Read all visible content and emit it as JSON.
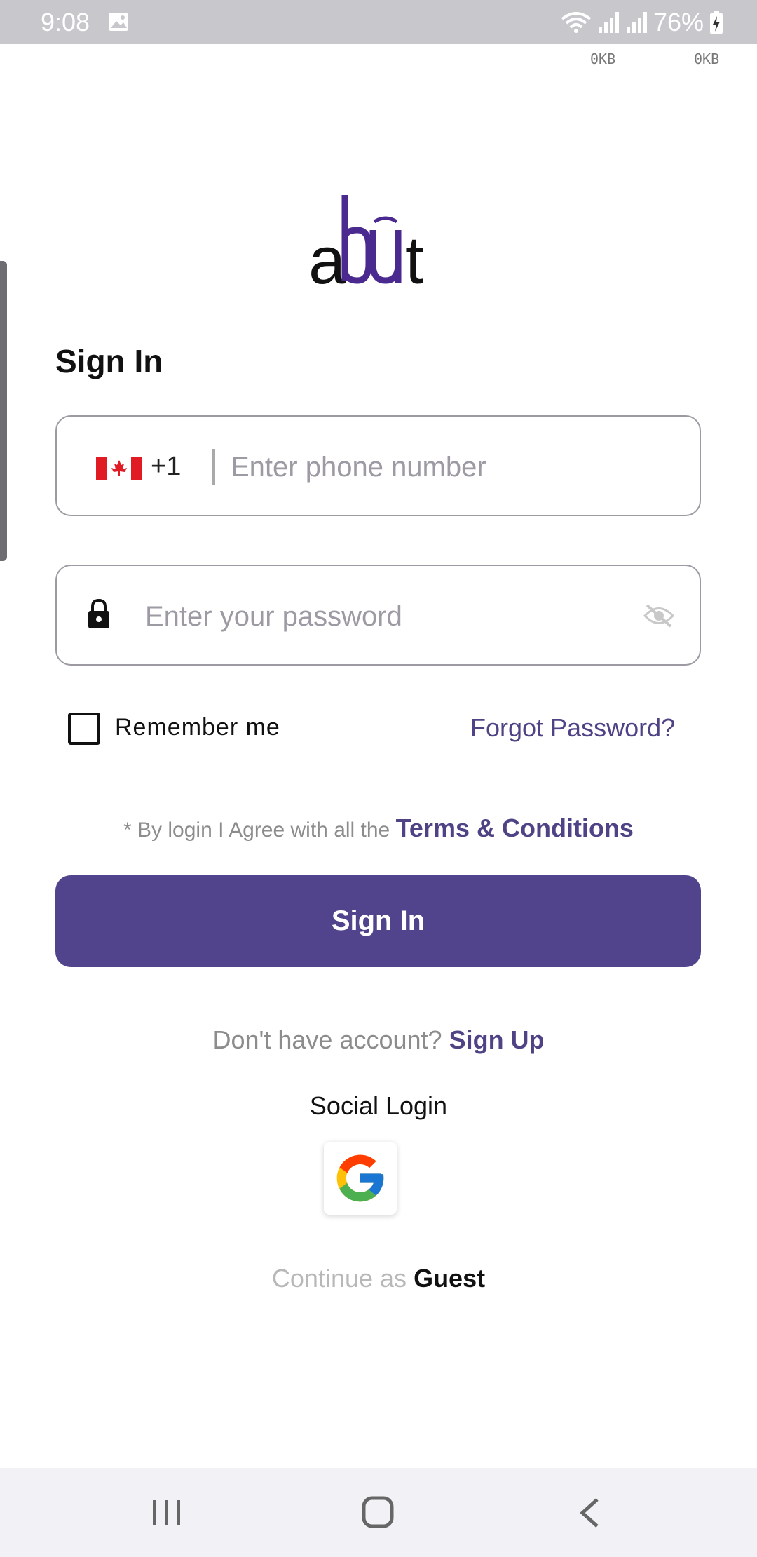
{
  "status_bar": {
    "time": "9:08",
    "battery_percent": "76%",
    "net_speed_up": "0KB",
    "net_speed_down": "0KB",
    "icons": [
      "gallery-icon",
      "wifi-icon",
      "signal-icon",
      "signal-icon",
      "battery-charging-icon"
    ]
  },
  "logo": {
    "text_a": "a",
    "text_b": "b",
    "text_u": "u",
    "text_t": "t",
    "colors": {
      "dark": "#111111",
      "accent": "#4b2a8f"
    }
  },
  "form": {
    "title": "Sign In",
    "phone": {
      "country_flag": "canada-flag-icon",
      "dial_code": "+1",
      "placeholder": "Enter phone number",
      "value": ""
    },
    "password": {
      "placeholder": "Enter your password",
      "value": "",
      "visibility": "hidden"
    },
    "remember_me": {
      "label": "Remember me",
      "checked": false
    },
    "forgot_password": "Forgot Password?",
    "terms": {
      "prefix": "* By login I Agree with all the",
      "link": "Terms & Conditions"
    },
    "submit_label": "Sign In"
  },
  "signup": {
    "prompt": "Don't have account?",
    "link": "Sign Up"
  },
  "social": {
    "label": "Social Login",
    "providers": [
      "google-icon"
    ]
  },
  "guest": {
    "prefix": "Continue as",
    "link": "Guest"
  },
  "colors": {
    "primary": "#51448d",
    "link": "#4f4386",
    "muted": "#8c8c8c",
    "border": "#9d9aa3"
  }
}
